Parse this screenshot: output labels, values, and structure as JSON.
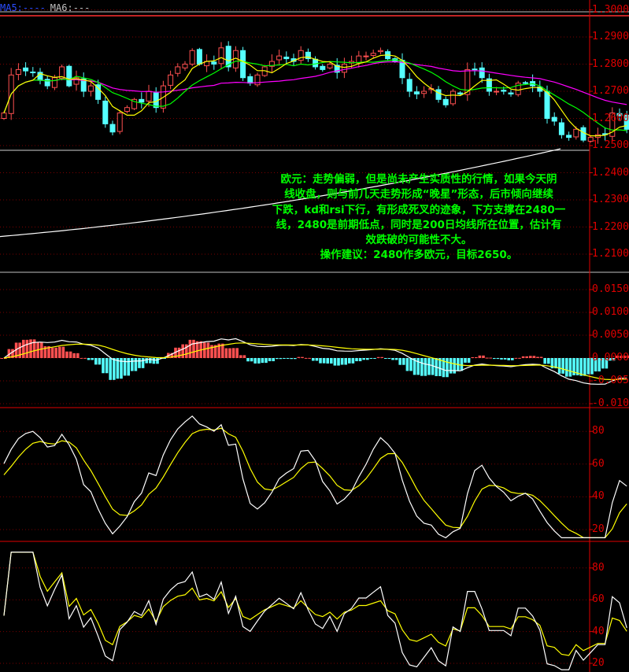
{
  "legend": {
    "ma5": "MA5:----",
    "ma6": "MA6:---"
  },
  "annotation": {
    "lines": [
      "欧元：走势偏弱，但是尚未产生实质性的行情，如果今天阴",
      "线收盘，则与前几天走势形成“晚星”形态，后市倾向继续",
      "下跌，kd和rsi下行，有形成死叉的迹象，下方支撑在2480一",
      "线，2480是前期低点，同时是200日均线所在位置，估计有",
      "效跌破的可能性不大。",
      "操作建议：2480作多欧元，目标2650。"
    ]
  },
  "colors": {
    "up": "#ff5050",
    "down": "#55ffff",
    "ma_short": "#ffff00",
    "ma_mid": "#00ff00",
    "ma_long": "#ff00ff",
    "ma200": "#ffffff",
    "axis": "#e00000",
    "k": "#ffffff",
    "d": "#ffff00"
  },
  "chart_data": [
    {
      "type": "candlestick",
      "title": "EUR/USD daily",
      "y_ticks": [
        "1.3000",
        "1.2900",
        "1.2800",
        "1.2700",
        "1.2600",
        "1.2500",
        "1.2400",
        "1.2300",
        "1.2200",
        "1.2100"
      ],
      "ylim": [
        1.205,
        1.3
      ],
      "closes": [
        1.262,
        1.276,
        1.278,
        1.2775,
        1.277,
        1.274,
        1.272,
        1.275,
        1.279,
        1.272,
        1.275,
        1.27,
        1.272,
        1.267,
        1.258,
        1.255,
        1.262,
        1.264,
        1.267,
        1.266,
        1.27,
        1.264,
        1.272,
        1.276,
        1.279,
        1.28,
        1.285,
        1.28,
        1.281,
        1.28,
        1.286,
        1.279,
        1.285,
        1.275,
        1.273,
        1.276,
        1.279,
        1.281,
        1.283,
        1.282,
        1.281,
        1.285,
        1.282,
        1.279,
        1.278,
        1.28,
        1.277,
        1.28,
        1.281,
        1.283,
        1.283,
        1.284,
        1.285,
        1.282,
        1.281,
        1.275,
        1.27,
        1.269,
        1.27,
        1.271,
        1.267,
        1.265,
        1.27,
        1.269,
        1.278,
        1.278,
        1.275,
        1.27,
        1.27,
        1.27,
        1.269,
        1.273,
        1.273,
        1.272,
        1.27,
        1.26,
        1.259,
        1.254,
        1.253,
        1.256,
        1.252,
        1.253,
        1.254,
        1.254,
        1.262,
        1.261,
        1.256
      ],
      "ma_periods": [
        5,
        10,
        30
      ],
      "ma200": {
        "start": 1.2165,
        "end": 1.2488
      }
    },
    {
      "type": "macd",
      "y_ticks": [
        "0.0150",
        "0.0100",
        "0.0050",
        "0.0000",
        "-0.0050",
        "-0.0100"
      ],
      "ylim": [
        -0.0105,
        0.0165
      ]
    },
    {
      "type": "kd",
      "y_ticks": [
        "80",
        "60",
        "40",
        "20"
      ],
      "ylim": [
        13,
        93
      ]
    },
    {
      "type": "rsi",
      "y_ticks": [
        "80",
        "60",
        "40",
        "20"
      ],
      "ylim": [
        15,
        93
      ]
    }
  ]
}
